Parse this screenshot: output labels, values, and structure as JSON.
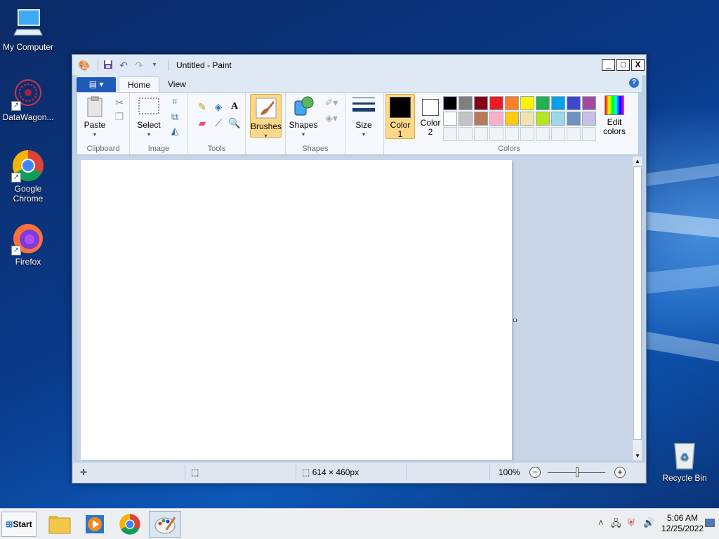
{
  "desktop": {
    "icons": [
      {
        "label": "My Computer",
        "icon": "computer-icon"
      },
      {
        "label": "DataWagon...",
        "icon": "datawagon-icon"
      },
      {
        "label": "Google Chrome",
        "icon": "chrome-icon"
      },
      {
        "label": "Firefox",
        "icon": "firefox-icon"
      },
      {
        "label": "Recycle Bin",
        "icon": "recycle-bin-icon"
      }
    ]
  },
  "window": {
    "title": "Untitled - Paint",
    "controls": {
      "minimize": "_",
      "maximize": "□",
      "close": "X"
    }
  },
  "ribbon": {
    "file_tab": "▤ ▾",
    "tabs": [
      {
        "label": "Home",
        "active": true
      },
      {
        "label": "View",
        "active": false
      }
    ],
    "groups": {
      "clipboard": {
        "label": "Clipboard",
        "paste": "Paste"
      },
      "image": {
        "label": "Image",
        "select": "Select"
      },
      "tools": {
        "label": "Tools"
      },
      "brushes": {
        "label": "Brushes"
      },
      "shapes": {
        "label": "Shapes",
        "button": "Shapes"
      },
      "size": {
        "label": "Size"
      },
      "colors": {
        "label": "Colors",
        "color1_line1": "Color",
        "color1_line2": "1",
        "color2_line1": "Color",
        "color2_line2": "2",
        "edit_line1": "Edit",
        "edit_line2": "colors",
        "color1_value": "#000000",
        "color2_value": "#ffffff",
        "palette": [
          "#000000",
          "#7f7f7f",
          "#880015",
          "#ed1c24",
          "#ff7f27",
          "#fff200",
          "#22b14c",
          "#00a2e8",
          "#3f48cc",
          "#a349a4",
          "#ffffff",
          "#c3c3c3",
          "#b97a57",
          "#ffaec9",
          "#ffc90e",
          "#efe4b0",
          "#b5e61d",
          "#99d9ea",
          "#7092be",
          "#c8bfe7"
        ]
      }
    }
  },
  "status": {
    "cursor_pos": "",
    "selection_size": "",
    "canvas_size": "614 × 460px",
    "file_size": "",
    "zoom": "100%"
  },
  "taskbar": {
    "start": "Start",
    "apps": [
      "file-explorer-icon",
      "media-player-icon",
      "chrome-icon",
      "paint-icon"
    ],
    "time": "5:06 AM",
    "date": "12/25/2022"
  }
}
